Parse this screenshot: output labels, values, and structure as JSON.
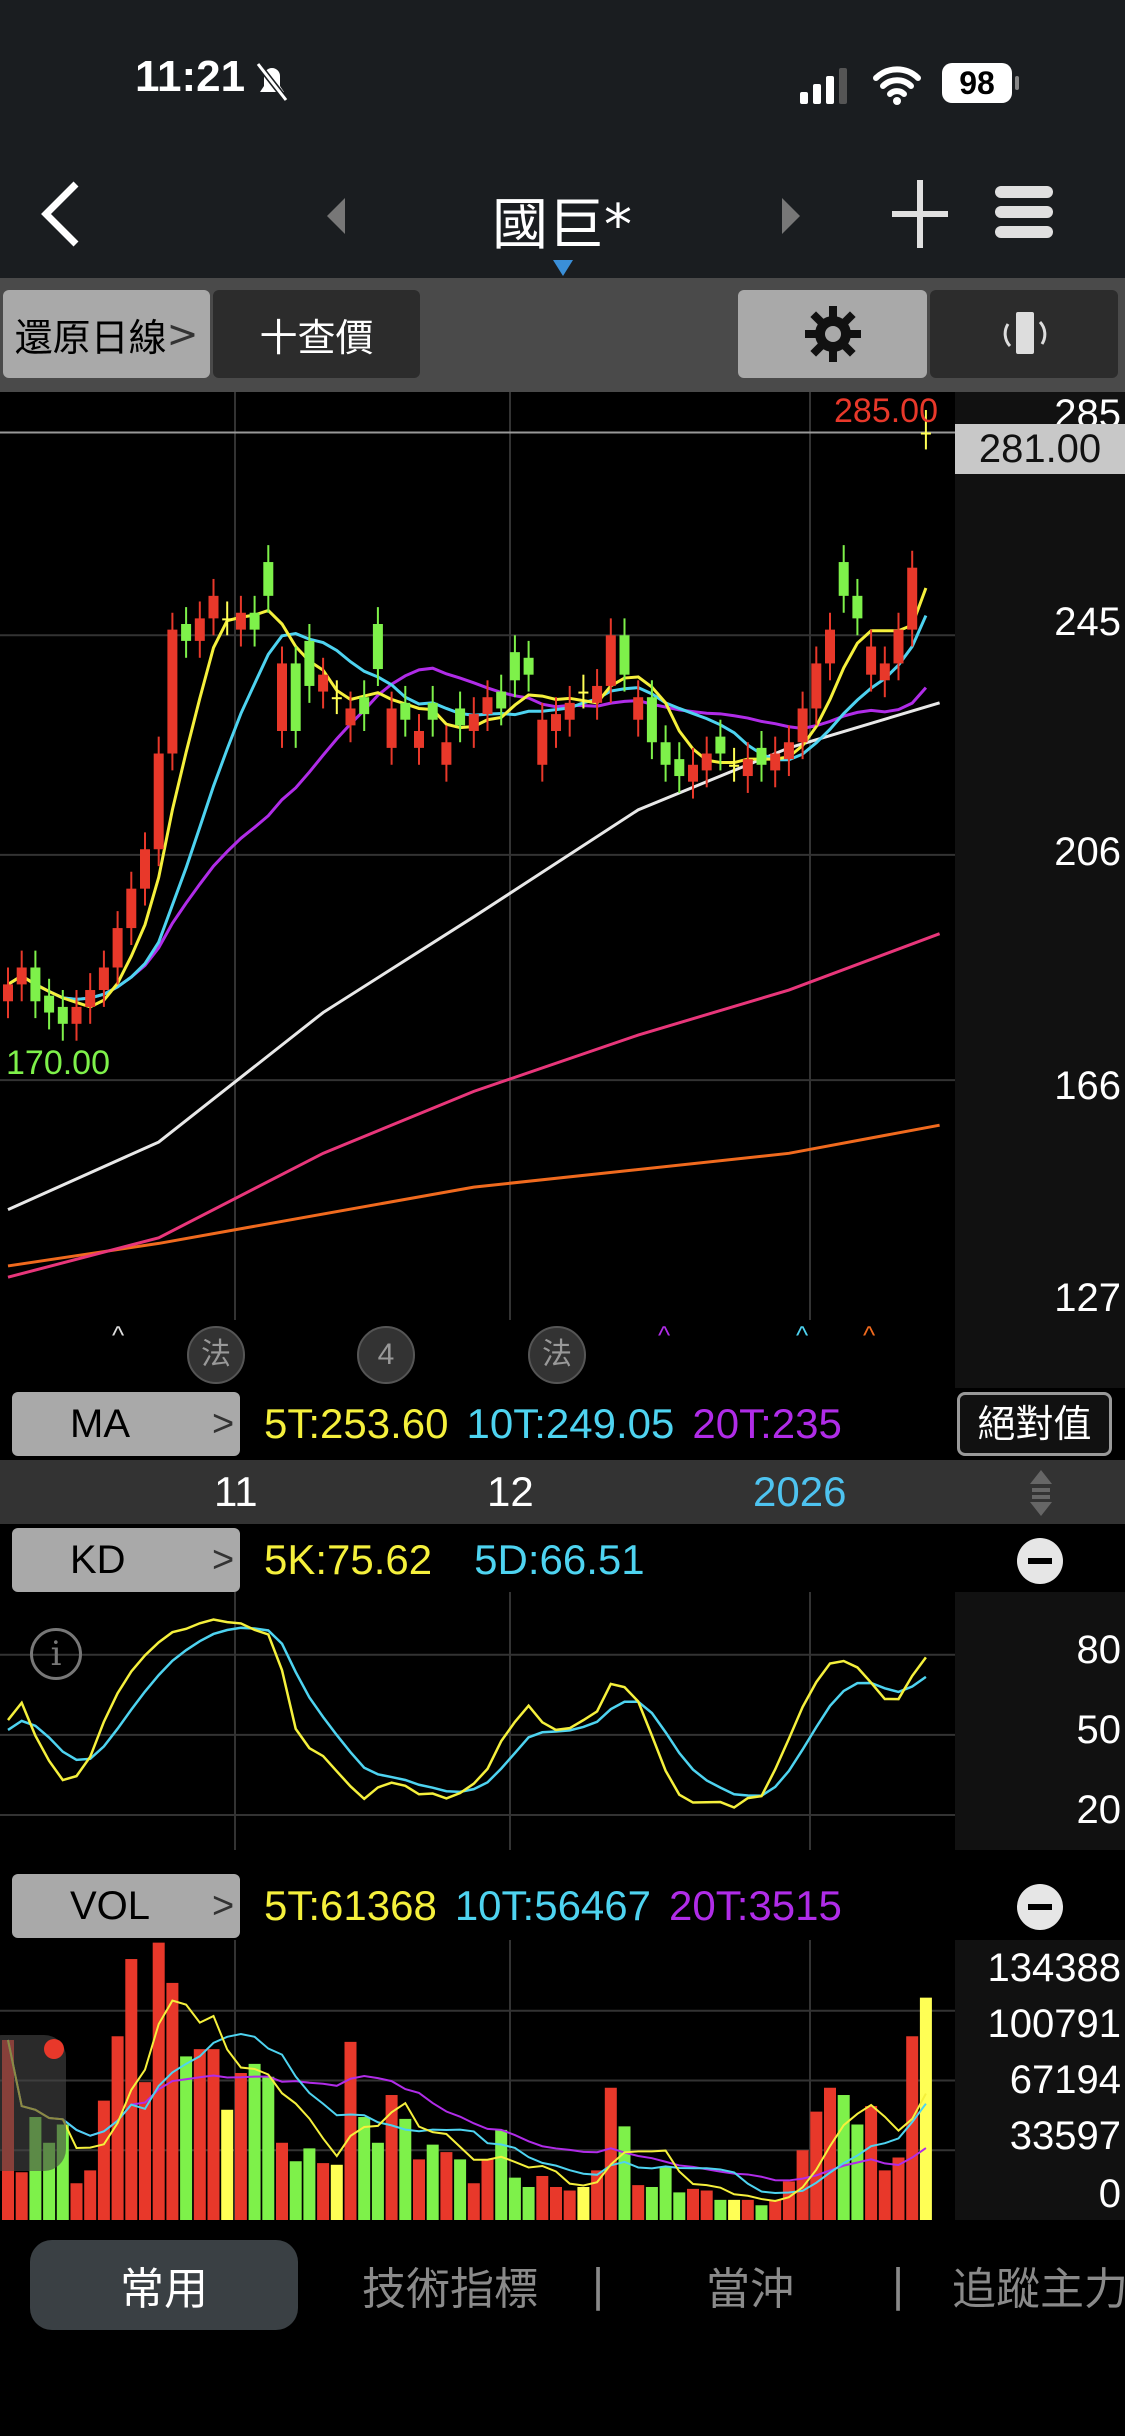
{
  "status": {
    "time": "11:21",
    "battery": "98"
  },
  "nav": {
    "title": "國巨*"
  },
  "toolbar": {
    "restore": "還原日線",
    "restore_chev": ">",
    "quote": "十查價"
  },
  "price_axis": {
    "labels": [
      "285",
      "245",
      "206",
      "166",
      "127"
    ],
    "high_label": "285.00",
    "current": "281.00",
    "low_label": "170.00"
  },
  "markers": [
    "法",
    "4",
    "法"
  ],
  "ma_row": {
    "label": "MA",
    "chev": ">",
    "v5": "5T:253.60",
    "v10": "10T:249.05",
    "v20": "20T:235",
    "abs": "絕對值"
  },
  "dates": {
    "d1": "11",
    "d2": "12",
    "d3": "2026"
  },
  "kd_row": {
    "label": "KD",
    "chev": ">",
    "k": "5K:75.62",
    "d": "5D:66.51",
    "axis": [
      "80",
      "50",
      "20"
    ]
  },
  "vol_row": {
    "label": "VOL",
    "chev": ">",
    "v5": "5T:61368",
    "v10": "10T:56467",
    "v20": "20T:3515",
    "axis": [
      "134388",
      "100791",
      "67194",
      "33597",
      "0"
    ]
  },
  "tabs": {
    "t1": "常用",
    "t2": "技術指標",
    "sep": "|",
    "t3": "當沖",
    "t4": "追蹤主力"
  },
  "colors": {
    "up": "#e8382a",
    "down": "#7ef14a",
    "flat": "#ffff55",
    "ma5": "#f5f03c",
    "ma10": "#4ed3f0",
    "ma20": "#b02ce8",
    "ma60": "#e8e8e8",
    "ma120": "#e8367a",
    "ma240": "#f06a1e"
  },
  "chart_data": {
    "type": "candlestick",
    "price_range": [
      123.4,
      288.2
    ],
    "closes": [
      183,
      186,
      180,
      178,
      176,
      179,
      182,
      186,
      193,
      200,
      207,
      224,
      246,
      244,
      248,
      252,
      248,
      249,
      246,
      252,
      240,
      228,
      236,
      238,
      234,
      232,
      231,
      239,
      232,
      230,
      228,
      230,
      226,
      229,
      231,
      234,
      232,
      237,
      238,
      230,
      231,
      233,
      235,
      236,
      245,
      238,
      234,
      226,
      222,
      220,
      222,
      224,
      224,
      222,
      223,
      222,
      224,
      226,
      232,
      240,
      246,
      252,
      248,
      243,
      240,
      246,
      257,
      281
    ],
    "dir": "rrgggrrrrrrrrgrryrggrggryrggrgrgrgrrgggrrryrrgrgggrrgyrgrrrrrggrrrr",
    "last_high": 285,
    "volumes": [
      86700,
      23000,
      49600,
      37200,
      46000,
      17700,
      23900,
      57500,
      88500,
      125700,
      66400,
      133600,
      114200,
      78800,
      82300,
      82300,
      53100,
      70800,
      75200,
      69000,
      37200,
      28300,
      34500,
      27400,
      26600,
      85800,
      49600,
      37200,
      60200,
      48700,
      29200,
      36300,
      32700,
      29200,
      17700,
      29200,
      43400,
      20400,
      15900,
      21200,
      15900,
      14200,
      15900,
      23900,
      63700,
      45100,
      16800,
      15900,
      25700,
      13300,
      15000,
      14200,
      9700,
      9700,
      9700,
      7100,
      9700,
      18600,
      33600,
      52200,
      63700,
      60200,
      46000,
      54900,
      23900,
      30100,
      88500,
      107100
    ],
    "vol_max": 134388,
    "ma60": [
      [
        0,
        143
      ],
      [
        11,
        155
      ],
      [
        23,
        178
      ],
      [
        34,
        195
      ],
      [
        46,
        214
      ],
      [
        57,
        225
      ],
      [
        68,
        233
      ]
    ],
    "ma120": [
      [
        0,
        131
      ],
      [
        11,
        138
      ],
      [
        23,
        153
      ],
      [
        34,
        164
      ],
      [
        46,
        174
      ],
      [
        57,
        182
      ],
      [
        68,
        192
      ]
    ],
    "ma240": [
      [
        0,
        133
      ],
      [
        11,
        137
      ],
      [
        34,
        147
      ],
      [
        57,
        153
      ],
      [
        68,
        158
      ]
    ],
    "kd_range": [
      0,
      100
    ]
  }
}
